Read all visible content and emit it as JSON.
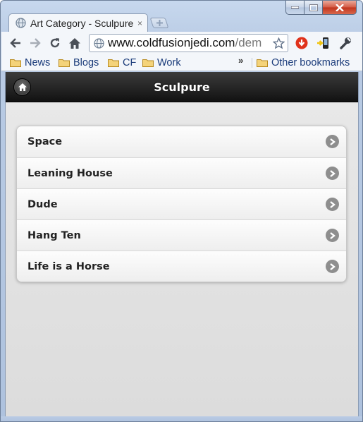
{
  "browser": {
    "tab_title": "Art Category - Sculpure",
    "tab_close": "×",
    "url_main": "www.coldfusionjedi.com",
    "url_rest": "/dem",
    "bookmarks": [
      {
        "label": "News"
      },
      {
        "label": "Blogs"
      },
      {
        "label": "CF"
      },
      {
        "label": "Work"
      }
    ],
    "overflow_chevron": "»",
    "other_bookmarks": "Other bookmarks"
  },
  "page": {
    "header_title": "Sculpure",
    "items": [
      {
        "label": "Space"
      },
      {
        "label": "Leaning House"
      },
      {
        "label": "Dude"
      },
      {
        "label": "Hang Ten"
      },
      {
        "label": "Life is a Horse"
      }
    ]
  },
  "colors": {
    "header_bg": "#1b1b1b",
    "list_arrow": "#8e8e8e",
    "page_bg": "#e2e2e2",
    "close_button": "#c0331c",
    "bookmark_text": "#1a3b7a"
  },
  "icons": {
    "minimize": "minimize-icon",
    "maximize": "maximize-icon",
    "close": "close-icon",
    "globe": "globe-icon",
    "back": "back-arrow-icon",
    "forward": "forward-arrow-icon",
    "reload": "reload-icon",
    "home": "home-icon",
    "star": "star-icon",
    "folder": "folder-icon",
    "chevron_right": "chevron-right-icon",
    "wrench": "wrench-icon"
  }
}
